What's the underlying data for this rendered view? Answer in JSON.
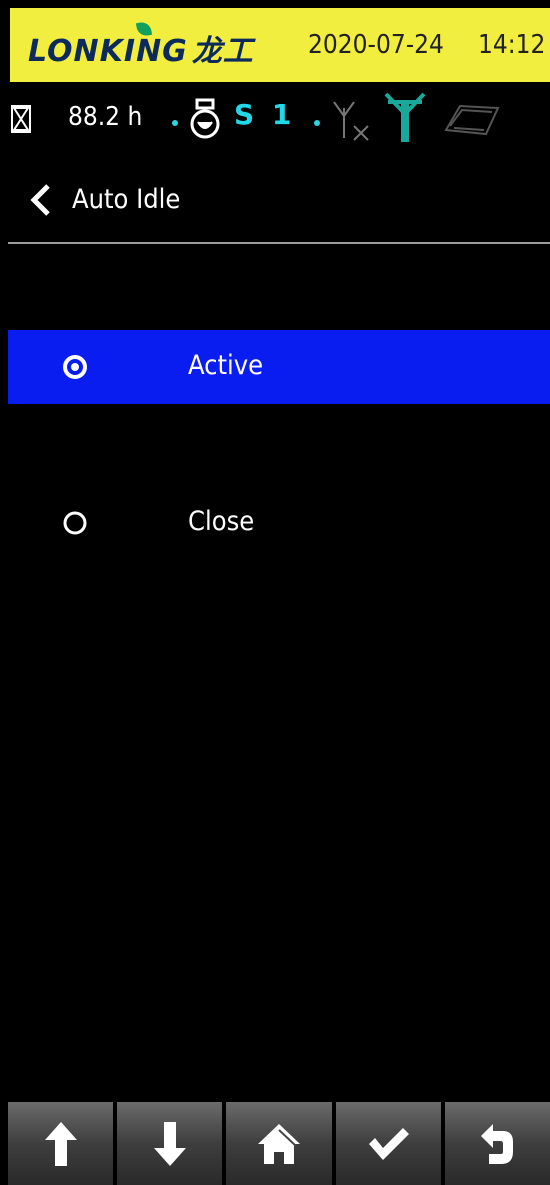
{
  "topbar": {
    "brand": "LONKING",
    "brand_cn": "龙工",
    "date": "2020-07-24",
    "time": "14:12"
  },
  "status": {
    "hours": "88.2 h",
    "speed": "S 1",
    "accent_color": "#22d8e8",
    "icons": [
      "hourglass-icon",
      "gear-shift-icon",
      "no-signal-icon",
      "antenna-icon",
      "book-icon"
    ]
  },
  "page": {
    "title": "Auto Idle"
  },
  "options": [
    {
      "label": "Active",
      "selected": true
    },
    {
      "label": "Close",
      "selected": false
    }
  ],
  "footer": {
    "buttons": [
      "up-arrow-icon",
      "down-arrow-icon",
      "home-icon",
      "check-icon",
      "return-icon"
    ]
  },
  "colors": {
    "topbar": "#f2ee3f",
    "selected": "#0a1df0"
  }
}
